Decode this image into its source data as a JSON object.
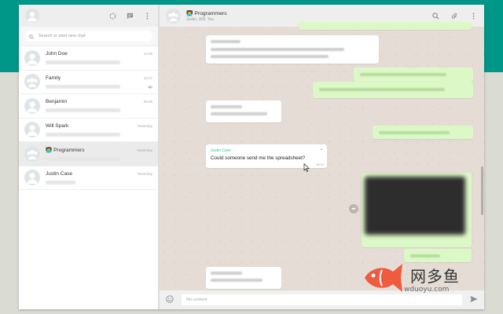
{
  "sidebar": {
    "search_placeholder": "Search or start new chat",
    "chats": [
      {
        "name": "John Doe",
        "time": "14:05",
        "emoji": "",
        "muted": false
      },
      {
        "name": "Family",
        "time": "10:27",
        "emoji": "",
        "muted": true
      },
      {
        "name": "Benjamin",
        "time": "09:39",
        "emoji": "",
        "muted": false
      },
      {
        "name": "Will Spark",
        "time": "Yesterday",
        "emoji": "",
        "muted": false
      },
      {
        "name": "Programmers",
        "time": "Yesterday",
        "emoji": "👨‍💻",
        "muted": false
      },
      {
        "name": "Justin Case",
        "time": "Yesterday",
        "emoji": "",
        "muted": false
      }
    ],
    "icons": {
      "status": "status-icon",
      "new_chat": "chat-icon",
      "menu": "menu-icon"
    }
  },
  "conversation": {
    "name": "Programmers",
    "emoji": "👨‍💻",
    "members": "Justin, Will, You",
    "focused_message": {
      "sender": "Justin Case",
      "text": "Could someone send me the spreadsheet?",
      "time": "18:03"
    },
    "compose_placeholder": "No content"
  },
  "watermark": {
    "text": "网多鱼",
    "url": "wduoyu.com"
  },
  "colors": {
    "brand": "#009688",
    "out_bubble": "#dcf8c6",
    "in_bubble": "#ffffff",
    "sender": "#35cd96"
  }
}
